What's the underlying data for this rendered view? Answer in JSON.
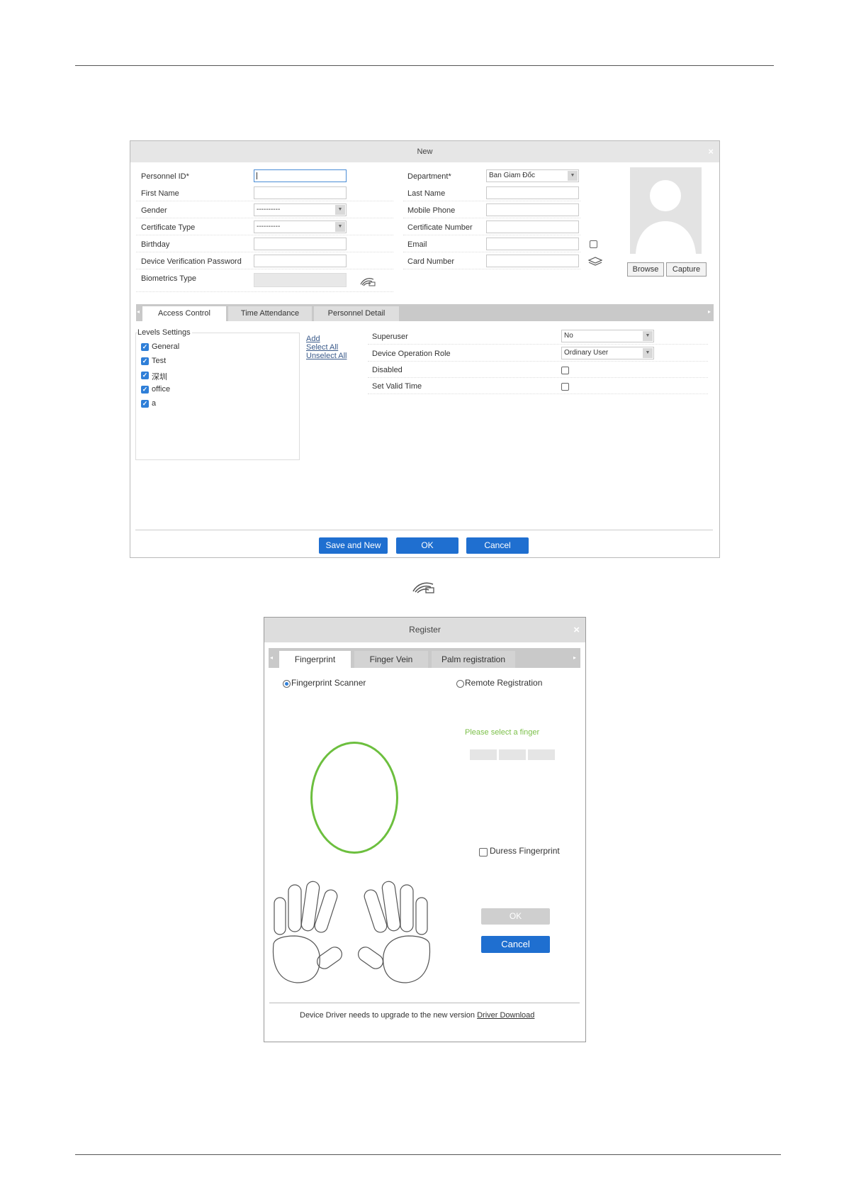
{
  "new_dialog": {
    "title": "New",
    "fields_left": [
      {
        "label": "Personnel ID*",
        "value": ""
      },
      {
        "label": "First Name",
        "value": ""
      },
      {
        "label": "Gender",
        "value": "----------"
      },
      {
        "label": "Certificate Type",
        "value": "----------"
      },
      {
        "label": "Birthday",
        "value": ""
      },
      {
        "label": "Device Verification Password",
        "value": ""
      },
      {
        "label": "Biometrics Type",
        "value": ""
      }
    ],
    "fields_right": [
      {
        "label": "Department*",
        "value": "Ban Giam Đốc"
      },
      {
        "label": "Last Name",
        "value": ""
      },
      {
        "label": "Mobile Phone",
        "value": ""
      },
      {
        "label": "Certificate Number",
        "value": ""
      },
      {
        "label": "Email",
        "value": ""
      },
      {
        "label": "Card Number",
        "value": ""
      }
    ],
    "browse_label": "Browse",
    "capture_label": "Capture",
    "tabs": [
      "Access Control",
      "Time Attendance",
      "Personnel Detail"
    ],
    "levels_title": "Levels Settings",
    "levels": [
      {
        "label": "General",
        "checked": true
      },
      {
        "label": "Test",
        "checked": true
      },
      {
        "label": "深圳",
        "checked": true
      },
      {
        "label": "office",
        "checked": true
      },
      {
        "label": "a",
        "checked": true
      }
    ],
    "links": [
      "Add",
      "Select All",
      "Unselect All"
    ],
    "settings": [
      {
        "label": "Superuser",
        "value": "No"
      },
      {
        "label": "Device Operation Role",
        "value": "Ordinary User"
      },
      {
        "label": "Disabled",
        "value": ""
      },
      {
        "label": "Set Valid Time",
        "value": ""
      }
    ],
    "buttons": {
      "save_new": "Save and New",
      "ok": "OK",
      "cancel": "Cancel"
    }
  },
  "register_dialog": {
    "title": "Register",
    "tabs": [
      "Fingerprint",
      "Finger Vein",
      "Palm registration"
    ],
    "radio_scanner": "Fingerprint Scanner",
    "radio_remote": "Remote Registration",
    "select_finger": "Please select a finger",
    "duress": "Duress Fingerprint",
    "ok": "OK",
    "cancel": "Cancel",
    "driver_msg": "Device Driver needs to upgrade to the new version",
    "driver_link": "Driver Download"
  },
  "colors": {
    "accent": "#1f6fd0",
    "ring": "#6cbf3e",
    "hint": "#7cc04a"
  }
}
